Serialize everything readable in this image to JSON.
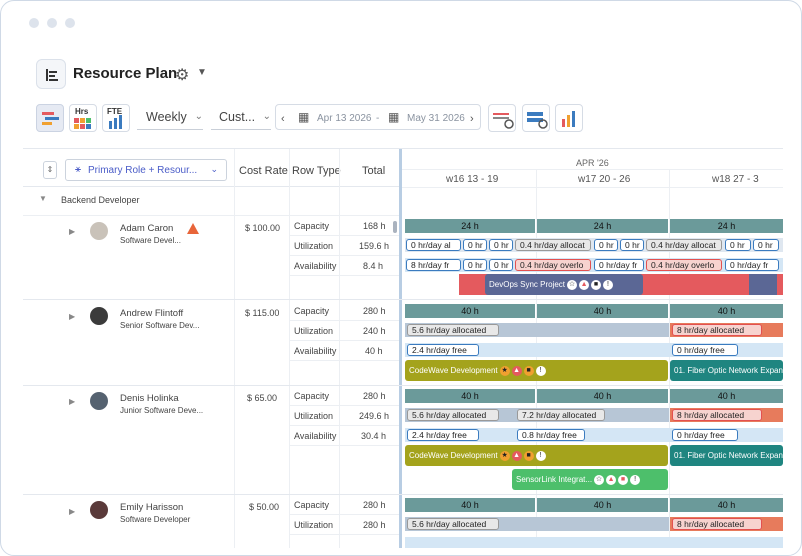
{
  "app": {
    "title": "Resource Plan"
  },
  "toolbar": {
    "view_hrs": "Hrs",
    "view_fte": "FTE",
    "period": "Weekly",
    "range_mode": "Cust...",
    "date_from": "Apr 13 2026",
    "date_sep": "-",
    "date_to": "May 31 2026"
  },
  "grid": {
    "headers": {
      "group": "Primary Role + Resour...",
      "cost": "Cost Rate",
      "rowtype": "Row Type",
      "total": "Total"
    },
    "timeline": {
      "month": "APR '26",
      "weeks": [
        "w16 13 - 19",
        "w17 20 - 26",
        "w18 27 - 3"
      ]
    },
    "group_label": "Backend Developer",
    "resources": [
      {
        "name": "Adam Caron",
        "role": "Software Devel...",
        "cost": "$ 100.00",
        "capacity": "168 h",
        "utilization": "159.6 h",
        "availability": "8.4 h"
      },
      {
        "name": "Andrew Flintoff",
        "role": "Senior Software Dev...",
        "cost": "$ 115.00",
        "capacity": "280 h",
        "utilization": "240 h",
        "availability": "40 h"
      },
      {
        "name": "Denis Holinka",
        "role": "Junior Software Deve...",
        "cost": "$ 65.00",
        "capacity": "280 h",
        "utilization": "249.6 h",
        "availability": "30.4 h"
      },
      {
        "name": "Emily Harisson",
        "role": "Software Developer",
        "cost": "$ 50.00",
        "capacity": "280 h",
        "utilization": "280 h",
        "availability": ""
      }
    ],
    "row_types": {
      "capacity": "Capacity",
      "utilization": "Utilization",
      "availability": "Availability"
    },
    "cap_24": "24 h",
    "cap_40": "40 h",
    "util": {
      "adam": [
        "0 hr/day al",
        "0 hr",
        "0 hr",
        "0.4 hr/day allocat",
        "0 hr",
        "0 hr",
        "0.4 hr/day allocat",
        "0 hr",
        "0 hr"
      ],
      "adam_avail": [
        "8 hr/day fr",
        "0 hr",
        "0 hr",
        "0.4 hr/day overlo",
        "0 hr/day fr",
        "0.4 hr/day overlo",
        "0 hr/day fr"
      ],
      "andrew_alloc": "5.6 hr/day allocated",
      "andrew_alloc2": "8 hr/day allocated",
      "andrew_free": "2.4 hr/day free",
      "andrew_free2": "0 hr/day free",
      "denis_alloc": "5.6 hr/day allocated",
      "denis_alloc_mid": "7.2 hr/day allocated",
      "denis_alloc2": "8 hr/day allocated",
      "denis_free": "2.4 hr/day free",
      "denis_free_mid": "0.8 hr/day free",
      "denis_free2": "0 hr/day free",
      "emily_alloc": "5.6 hr/day allocated",
      "emily_alloc2": "8 hr/day allocated"
    },
    "projects": {
      "devops": "DevOps Sync Project",
      "codewave": "CodeWave Development",
      "fiber": "01. Fiber Optic Network Expan",
      "sensor": "SensorLink Integrat..."
    }
  },
  "colors": {
    "capacity": "#6b9a9a",
    "devops": "#5b6795",
    "codewave": "#a4a31c",
    "fiber": "#1f8580",
    "sensor": "#4dbf6b",
    "overload": "#e45a5e"
  }
}
